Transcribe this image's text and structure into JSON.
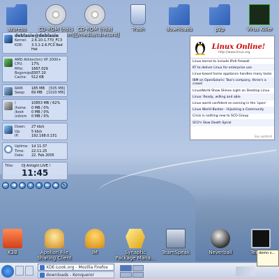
{
  "desktop_icons": [
    {
      "name": "azureus",
      "label": "azureus",
      "icon": "folder-icon"
    },
    {
      "name": "cdrom-hdc",
      "label": "CD-ROM (hdc) [/media/cdrom]",
      "icon": "cdrom-icon"
    },
    {
      "name": "cdrom-hda",
      "label": "CD-ROM (hda) [/media/cdrecord]",
      "icon": "cdrom-icon"
    },
    {
      "name": "trash",
      "label": "Trash",
      "icon": "trash-icon"
    },
    {
      "name": "downloads",
      "label": "downloads",
      "icon": "folder-icon"
    },
    {
      "name": "p2p",
      "label": "p2p",
      "icon": "folder-icon"
    },
    {
      "name": "virus-killer",
      "label": "Virus Killer",
      "icon": "virus-icon"
    }
  ],
  "monitor": {
    "host": "deblasie@deblasie",
    "kernel_label": "Kernel:",
    "kernel": "2.6.10-1.770_FC3",
    "kde_label": "KDE:",
    "kde": "3.3.1-2.6.FC3 Red Hat",
    "cpu_model": "AMD Athlon(tm) XP 2000+",
    "cpu_label": "CPU:",
    "cpu": "17%",
    "mhz_label": "MHz:",
    "mhz": "1667.029",
    "bogomips_label": "Bogomips:",
    "bogomips": "3307.10",
    "cache_label": "Cache:",
    "cache": "512 KB",
    "ram_label": "RAM:",
    "ram": "185 MB",
    "ram_total": "[505 MB]",
    "swap_label": "Swap:",
    "swap": "69 MB",
    "swap_total": "[1020 MB]",
    "disk_root_label": "/",
    "disk_root": "10853 MB / 62%",
    "disk_home_label": "/home",
    "disk_home": "0 MB / 0%",
    "disk_boot_label": "/boot",
    "disk_boot": "0 MB / 0%",
    "disk_cdrom_label": "/cdrom",
    "disk_cdrom": "0 MB / 0%",
    "down_label": "Down:",
    "down": "27 kb/s",
    "up_label": "Up:",
    "up": "5 kb/s",
    "ip_label": "IP:",
    "ip": "192.168.0.151",
    "uptime_label": "Uptime:",
    "uptime": "1d 11:37",
    "time_label": "Time:",
    "time": "22:11:25",
    "date_label": "Date:",
    "date": "22. Feb 2005",
    "title_label": "Title:",
    "title": "DJ Airtight LIVE !",
    "clock": "11:45"
  },
  "media_buttons": [
    "⏮",
    "◀",
    "▶",
    "⏸",
    "⏹",
    "⏭",
    "⏏",
    "🔊"
  ],
  "news": {
    "brand": "Linux Online!",
    "url": "http://www.linux.org",
    "items": [
      "Linux kernel to include IPv6 firewall",
      "KT to deliver Linux for enterprise use",
      "Linux-based home appliance handles many tasks",
      "IBM on OpenSolaris: Two's company, three's a crowd",
      "LinuxWorld Show Shines Light on Desktop Linux",
      "Linux: Ready, willing and able",
      "Linux world confident on earning in the 'open'",
      "Linux World Boston - Hijacking a Community",
      "Crisis is nothing new to SCO Group",
      "SCO's Slow Death Spiral"
    ],
    "footer": "Sep updated"
  },
  "launcher": [
    {
      "name": "k3b",
      "label": "K3B",
      "icon": "k3b-icon"
    },
    {
      "name": "apollon",
      "label": "Apollon File Sharing Client",
      "icon": "apollon-icon"
    },
    {
      "name": "im",
      "label": "IM",
      "icon": "im-icon"
    },
    {
      "name": "synaptic",
      "label": "Synaptic Package Mana...",
      "icon": "synaptic-icon"
    },
    {
      "name": "teamspeak",
      "label": "TeamSpeak",
      "icon": "teamspeak-icon"
    },
    {
      "name": "neverball",
      "label": "Neverball",
      "icon": "neverball-icon"
    },
    {
      "name": "terminal",
      "label": "Terminal",
      "icon": "terminal-icon"
    }
  ],
  "taskbar": {
    "tasks": [
      "XDE-Look.org - Mozilla Firefox",
      "downloads - Konqueror"
    ],
    "tooltip": "domn s..."
  }
}
